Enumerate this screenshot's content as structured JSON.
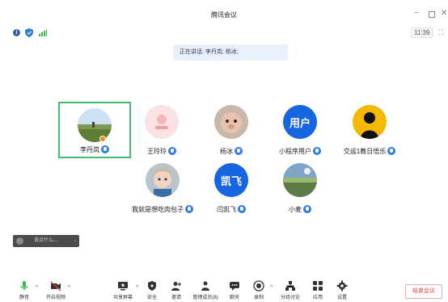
{
  "window": {
    "title": "腾讯会议",
    "minimize": "−",
    "close": "✕"
  },
  "status": {
    "time": "11:39",
    "fullscreen": "⛶"
  },
  "speaking": {
    "text": "正在讲话: 李丹岚; 杨冰;"
  },
  "participants": [
    {
      "name": "李丹岚",
      "avatar_type": "photo-grass",
      "active": true,
      "host_badge": true
    },
    {
      "name": "王玲玲",
      "avatar_type": "photo-pink"
    },
    {
      "name": "杨冰",
      "avatar_type": "photo-face"
    },
    {
      "name": "小程序用户",
      "avatar_type": "text",
      "avatar_text": "用户"
    },
    {
      "name": "交运1教日悟乐",
      "avatar_type": "silhouette"
    },
    {
      "name": "我就是想吃肉包子",
      "avatar_type": "photo-baby"
    },
    {
      "name": "闫凯飞",
      "avatar_type": "text",
      "avatar_text": "凯飞"
    },
    {
      "name": "小麦",
      "avatar_type": "photo-field"
    }
  ],
  "chat": {
    "placeholder": "说点什么...",
    "arrow": "‹"
  },
  "toolbar": {
    "items": [
      {
        "label": "静音",
        "icon": "microphone-icon",
        "color": "#3cb84a"
      },
      {
        "label": "开启视频",
        "icon": "video-off-icon",
        "color": "#d83b3b"
      },
      {
        "label": "共享屏幕",
        "icon": "share-screen-icon",
        "color": "#333333"
      },
      {
        "label": "安全",
        "icon": "shield-icon",
        "color": "#333333"
      },
      {
        "label": "邀请",
        "icon": "invite-user-icon",
        "color": "#333333"
      },
      {
        "label": "管理成员(8)",
        "icon": "members-icon",
        "color": "#333333"
      },
      {
        "label": "聊天",
        "icon": "chat-icon",
        "color": "#333333"
      },
      {
        "label": "录制",
        "icon": "record-icon",
        "color": "#333333"
      },
      {
        "label": "分组讨论",
        "icon": "breakout-icon",
        "color": "#333333"
      },
      {
        "label": "应用",
        "icon": "apps-icon",
        "color": "#333333"
      },
      {
        "label": "设置",
        "icon": "gear-icon",
        "color": "#333333"
      }
    ],
    "end_label": "结束会议"
  }
}
